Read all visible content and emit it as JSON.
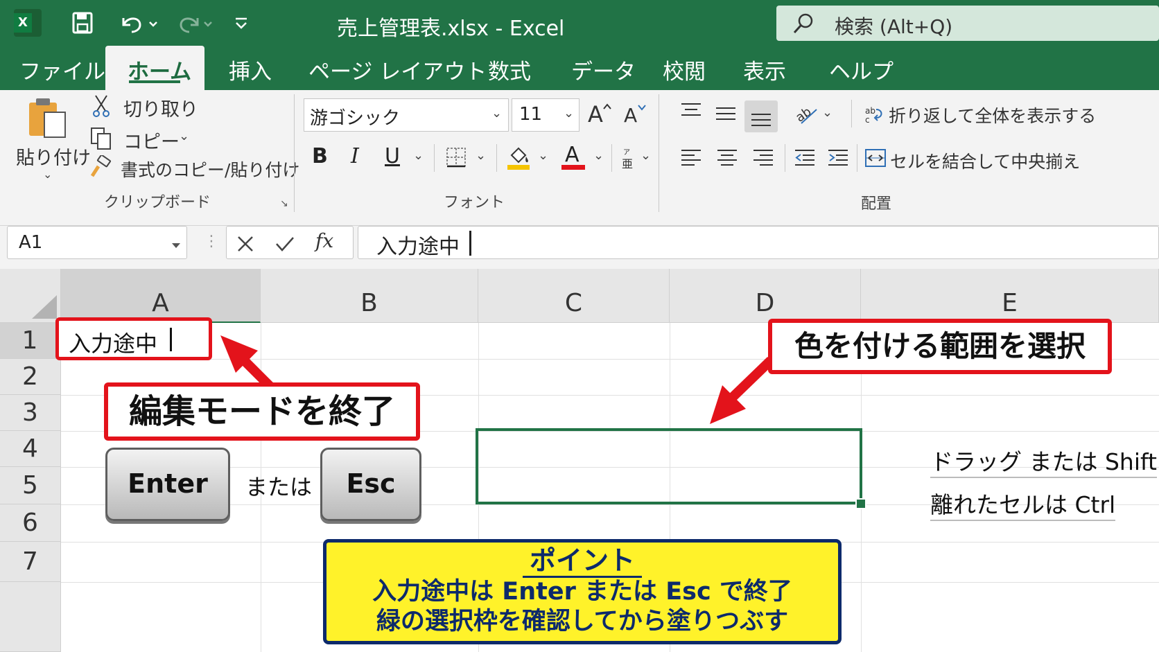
{
  "titlebar": {
    "app_icon": "X",
    "title": "売上管理表.xlsx  -  Excel",
    "search_placeholder": "検索 (Alt+Q)",
    "save_icon": "save-icon",
    "undo_icon": "undo-icon",
    "redo_icon": "redo-icon",
    "qat_icon": "customize-qat-icon"
  },
  "tabs": [
    "ファイル",
    "ホーム",
    "挿入",
    "ページ レイアウト",
    "数式",
    "データ",
    "校閲",
    "表示",
    "ヘルプ"
  ],
  "active_tab": "ホーム",
  "ribbon": {
    "clipboard": {
      "paste": "貼り付け",
      "cut": "切り取り",
      "copy": "コピー",
      "format_painter": "書式のコピー/貼り付け",
      "group": "クリップボード"
    },
    "font": {
      "name": "游ゴシック",
      "size": "11",
      "bold": "B",
      "italic": "I",
      "underline": "U",
      "font_color_letter": "A",
      "grow": "A",
      "shrink": "A",
      "group": "フォント"
    },
    "alignment": {
      "wrap": "折り返して全体を表示する",
      "merge": "セルを結合して中央揃え",
      "group": "配置"
    }
  },
  "formula_bar": {
    "name_box": "A1",
    "fx": "fx",
    "content": "入力途中"
  },
  "sheet": {
    "columns": [
      "A",
      "B",
      "C",
      "D",
      "E"
    ],
    "rows": [
      "1",
      "2",
      "3",
      "4",
      "5",
      "6",
      "7"
    ],
    "cell_a1": "入力途中"
  },
  "annotations": {
    "exit_edit": "編集モードを終了",
    "key_enter": "Enter",
    "or": "または",
    "key_esc": "Esc",
    "select_range": "色を付ける範囲を選択",
    "drag_tip": "ドラッグ または Shift",
    "ctrl_tip": "離れたセルは Ctrl",
    "point_title": "ポイント",
    "point_line1": "入力途中は Enter または Esc で終了",
    "point_line2": "緑の選択枠を確認してから塗りつぶす"
  },
  "colors": {
    "excel_green": "#217346",
    "callout_red": "#e3131b",
    "point_yellow": "#fff22a",
    "point_border": "#0d2a6b",
    "fill_yellow": "#f5c400",
    "font_red": "#e3131b"
  }
}
